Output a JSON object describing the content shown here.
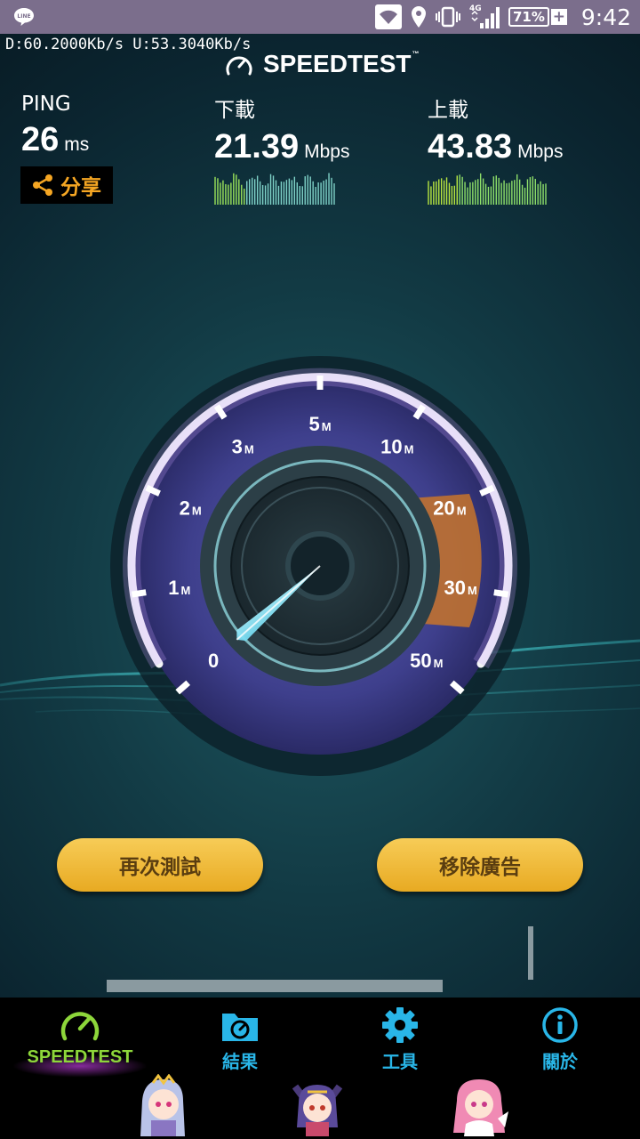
{
  "status_bar": {
    "time": "9:42",
    "battery": "71%",
    "network": "4G",
    "left_icon": "line-app-icon",
    "icons": [
      "wifi-icon",
      "location-icon",
      "vibrate-icon",
      "signal-icon",
      "battery-icon"
    ]
  },
  "speed_overlay": "D:60.2000Kb/s U:53.3040Kb/s",
  "logo": {
    "text": "SPEEDTEST",
    "tm": "™"
  },
  "ping": {
    "label": "PING",
    "value": "26",
    "unit": "ms"
  },
  "download": {
    "label": "下載",
    "value": "21.39",
    "unit": "Mbps"
  },
  "upload": {
    "label": "上載",
    "value": "43.83",
    "unit": "Mbps"
  },
  "share": {
    "label": "分享"
  },
  "gauge": {
    "ticks": [
      {
        "num": "0",
        "suffix": ""
      },
      {
        "num": "1",
        "suffix": "M"
      },
      {
        "num": "2",
        "suffix": "M"
      },
      {
        "num": "3",
        "suffix": "M"
      },
      {
        "num": "5",
        "suffix": "M"
      },
      {
        "num": "10",
        "suffix": "M"
      },
      {
        "num": "20",
        "suffix": "M"
      },
      {
        "num": "30",
        "suffix": "M"
      },
      {
        "num": "50",
        "suffix": "M"
      }
    ],
    "needle_value_mbps": 0
  },
  "buttons": {
    "retest": "再次測試",
    "remove_ads": "移除廣告"
  },
  "nav": [
    {
      "label": "SPEEDTEST",
      "icon": "speedometer-icon",
      "color": "#8dd63a",
      "active": true
    },
    {
      "label": "結果",
      "icon": "results-folder-icon",
      "color": "#29b6e8",
      "active": false
    },
    {
      "label": "工具",
      "icon": "gear-icon",
      "color": "#29b6e8",
      "active": false
    },
    {
      "label": "關於",
      "icon": "info-icon",
      "color": "#29b6e8",
      "active": false
    }
  ],
  "colors": {
    "accent_orange": "#f5a623",
    "nav_active": "#8dd63a",
    "nav_inactive": "#29b6e8",
    "button_gold": "#f0b833"
  }
}
